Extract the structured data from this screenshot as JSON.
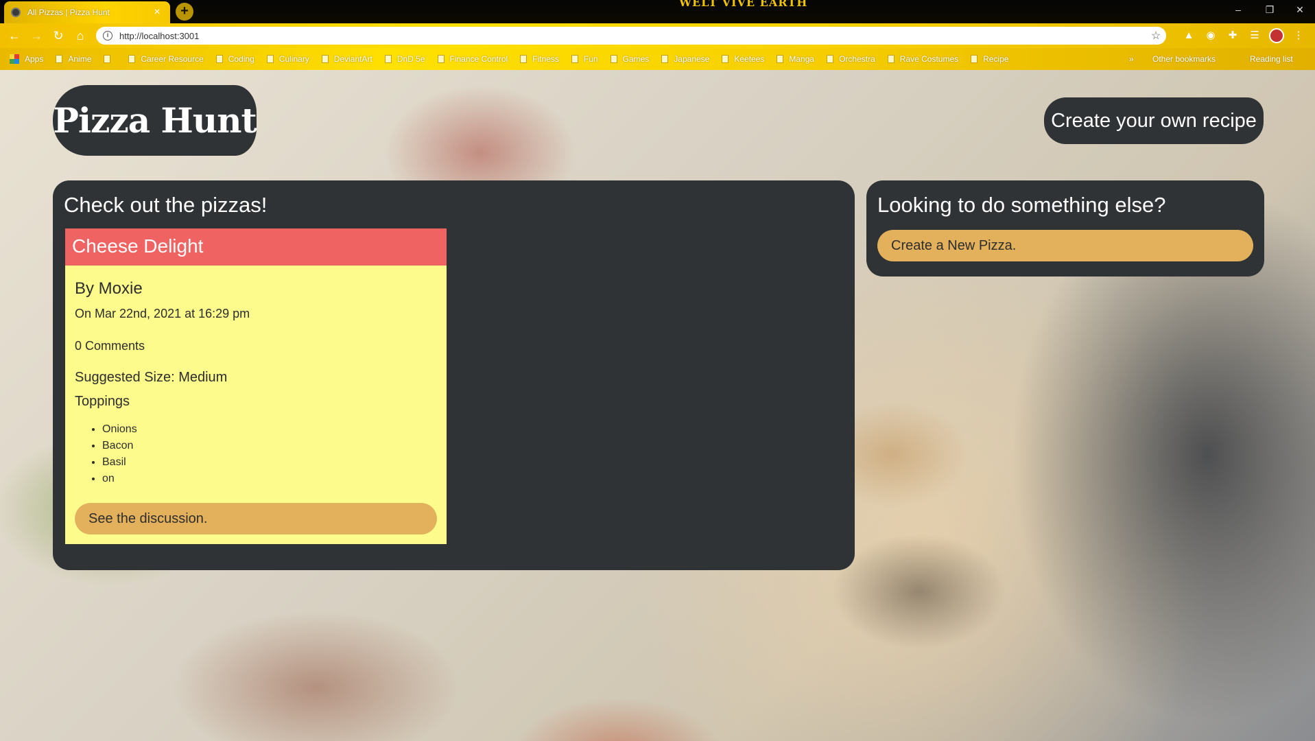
{
  "browser": {
    "tab_title": "All Pizzas | Pizza Hunt",
    "tab_close": "×",
    "new_tab": "+",
    "url": "http://localhost:3001",
    "banner": "WELT VIVE EARTH",
    "window_controls": [
      "–",
      "❐",
      "✕"
    ],
    "bookmarks": [
      {
        "label": "Apps",
        "icon": "apps-grid-icon"
      },
      {
        "label": "Anime",
        "icon": "folder-icon"
      },
      {
        "label": "",
        "icon": "folder-icon"
      },
      {
        "label": "Career Resource",
        "icon": "folder-icon"
      },
      {
        "label": "Coding",
        "icon": "folder-icon"
      },
      {
        "label": "Culinary",
        "icon": "folder-icon"
      },
      {
        "label": "DeviantArt",
        "icon": "folder-icon"
      },
      {
        "label": "DnD 5e",
        "icon": "folder-icon"
      },
      {
        "label": "Finance Control",
        "icon": "folder-icon"
      },
      {
        "label": "Fitness",
        "icon": "folder-icon"
      },
      {
        "label": "Fun",
        "icon": "folder-icon"
      },
      {
        "label": "Games",
        "icon": "folder-icon"
      },
      {
        "label": "Japanese",
        "icon": "folder-icon"
      },
      {
        "label": "Keetees",
        "icon": "folder-icon"
      },
      {
        "label": "Manga",
        "icon": "folder-icon"
      },
      {
        "label": "Orchestra",
        "icon": "folder-icon"
      },
      {
        "label": "Rave Costumes",
        "icon": "folder-icon"
      },
      {
        "label": "Recipe",
        "icon": "folder-icon"
      }
    ],
    "bookmarks_overflow": "»",
    "other_bookmarks": "Other bookmarks",
    "reading_list": "Reading list"
  },
  "header": {
    "logo": "Pizza Hunt",
    "create_recipe": "Create your own recipe"
  },
  "main": {
    "title": "Check out the pizzas!",
    "pizzas": [
      {
        "name": "Cheese Delight",
        "author": "By Moxie",
        "date": "On Mar 22nd, 2021 at 16:29 pm",
        "comments": "0 Comments",
        "size": "Suggested Size: Medium",
        "toppings_label": "Toppings",
        "toppings": [
          "Onions",
          "Bacon",
          "Basil",
          "on"
        ],
        "discussion_button": "See the discussion."
      }
    ]
  },
  "sidebar": {
    "title": "Looking to do something else?",
    "new_pizza_button": "Create a New Pizza."
  },
  "colors": {
    "panel": "#2f3336",
    "card_header": "#ef6363",
    "card_body": "#fdfb8b",
    "button": "#e3b15c",
    "browser_theme": "#ffd400"
  }
}
